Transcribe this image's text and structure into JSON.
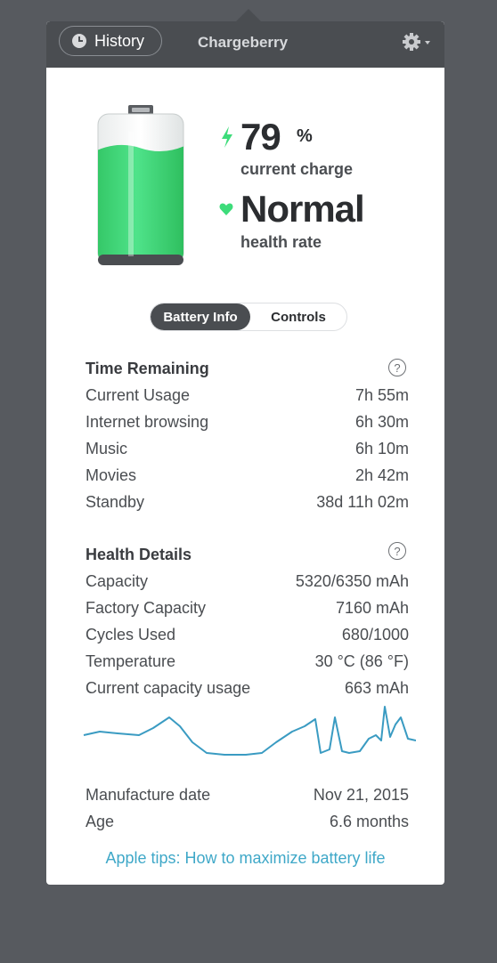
{
  "header": {
    "history_label": "History",
    "app_title": "Chargeberry",
    "history_icon": "clock-icon",
    "settings_icon": "gear-icon"
  },
  "charge": {
    "value": "79",
    "unit": "%",
    "label": "current charge",
    "level": 0.79,
    "icon": "lightning-icon"
  },
  "health": {
    "value": "Normal",
    "label": "health rate",
    "icon": "heart-icon"
  },
  "tabs": [
    {
      "label": "Battery Info",
      "active": true
    },
    {
      "label": "Controls",
      "active": false
    }
  ],
  "time_remaining": {
    "title": "Time Remaining",
    "help": "?",
    "rows": [
      {
        "label": "Current Usage",
        "value": "7h 55m"
      },
      {
        "label": "Internet browsing",
        "value": "6h 30m"
      },
      {
        "label": "Music",
        "value": "6h 10m"
      },
      {
        "label": "Movies",
        "value": "2h 42m"
      },
      {
        "label": "Standby",
        "value": "38d 11h 02m"
      }
    ]
  },
  "health_details": {
    "title": "Health Details",
    "help": "?",
    "rows": [
      {
        "label": "Capacity",
        "value": "5320/6350 mAh"
      },
      {
        "label": "Factory Capacity",
        "value": "7160 mAh"
      },
      {
        "label": "Cycles Used",
        "value": "680/1000"
      },
      {
        "label": "Temperature",
        "value": "30 °C (86 °F)"
      },
      {
        "label": "Current capacity usage",
        "value": "663 mAh"
      }
    ]
  },
  "misc": {
    "rows": [
      {
        "label": "Manufacture date",
        "value": "Nov 21, 2015"
      },
      {
        "label": "Age",
        "value": "6.6 months"
      }
    ]
  },
  "link_text": "Apple tips: How to maximize battery life",
  "colors": {
    "accent_green": "#3ddc7a",
    "link_blue": "#3fa8c8",
    "sparkline": "#3a9bc2",
    "header_bg": "#4a4d51"
  }
}
